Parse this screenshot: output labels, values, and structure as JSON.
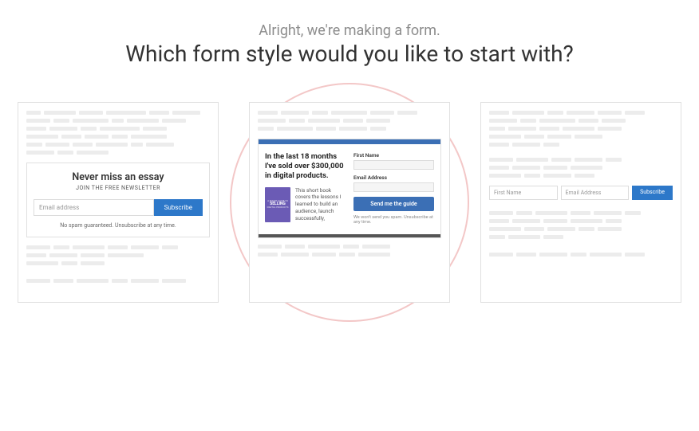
{
  "header": {
    "subtitle": "Alright, we're making a form.",
    "title": "Which form style would you like to start with?"
  },
  "card1": {
    "heading": "Never miss an essay",
    "subheading": "JOIN THE FREE NEWSLETTER",
    "email_placeholder": "Email address",
    "button": "Subscribe",
    "footer": "No spam guaranteed. Unsubscribe at any time."
  },
  "card2": {
    "heading": "In the last 18 months I've sold over $300,000 in digital products.",
    "book_top": "A SHORT GUIDE TO",
    "book_title": "SELLING",
    "book_sub": "DIGITAL PRODUCTS",
    "desc": "This short book covers the lessons I learned to build an audience, launch successfully,",
    "label_first": "First Name",
    "label_email": "Email Address",
    "button": "Send me the guide",
    "footer": "We won't send you spam. Unsubscribe at any time."
  },
  "card3": {
    "first_placeholder": "First Name",
    "email_placeholder": "Email Address",
    "button": "Subscribe"
  }
}
